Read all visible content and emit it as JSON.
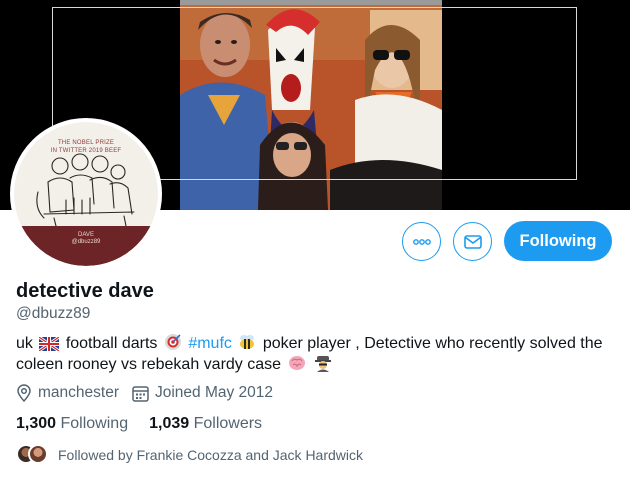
{
  "header": {
    "banner_icon": "banner-photo"
  },
  "avatar": {
    "icon": "profile-avatar",
    "top_text": "THE NOBEL PRIZE\nIN TWITTER 2019 BEEF",
    "band_text": "DAVE\n@dbuzz89"
  },
  "actions": {
    "more_icon": "more-icon",
    "message_icon": "envelope-icon",
    "follow_label": "Following"
  },
  "profile": {
    "display_name": "detective dave",
    "handle": "@dbuzz89",
    "bio": {
      "part1": "uk",
      "part2": "football darts",
      "hashtag": "#mufc",
      "part3": "poker player , Detective who recently solved the coleen rooney vs rebekah vardy case",
      "emojis": [
        "uk-flag-icon",
        "dart-target-icon",
        "bee-icon",
        "brain-icon",
        "detective-icon"
      ]
    },
    "location": "manchester",
    "joined": "Joined May 2012",
    "following_count": "1,300",
    "following_label": "Following",
    "followers_count": "1,039",
    "followers_label": "Followers",
    "followed_by": "Followed by Frankie Cocozza and Jack Hardwick"
  },
  "colors": {
    "accent": "#1d9bf0",
    "secondary_text": "#536471",
    "banner_bg": "#000000",
    "avatar_band": "#6c2427"
  }
}
